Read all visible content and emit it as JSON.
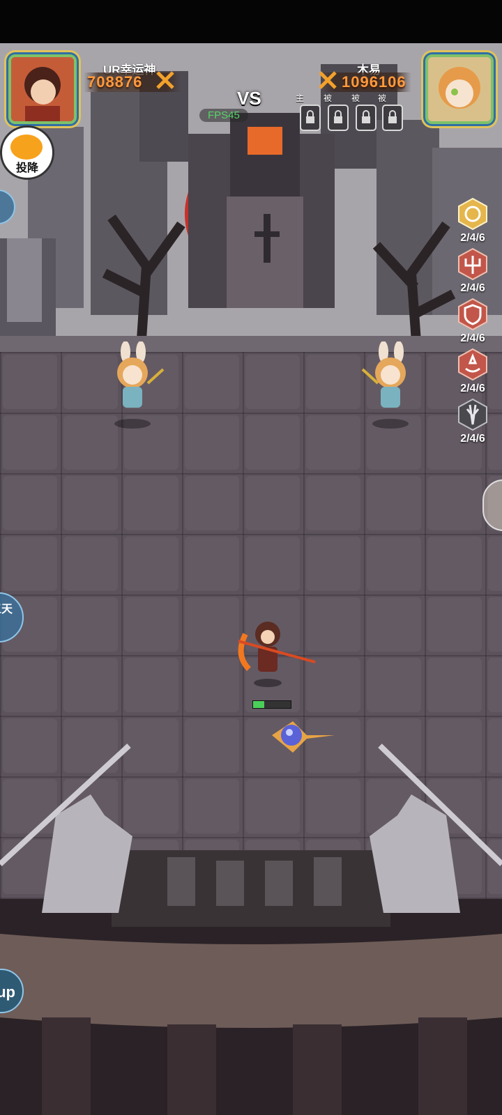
{
  "players": {
    "left": {
      "name": "UR幸运神",
      "power": "708876"
    },
    "right": {
      "name": "木易",
      "power": "1096106"
    }
  },
  "vs_label": "VS",
  "fps_label": "FPS45",
  "lock_slots": [
    "主",
    "被",
    "被",
    "被"
  ],
  "surrender_label": "投降",
  "skills": [
    {
      "icon": "sun-swirl-icon",
      "count": "2/4/6",
      "color": "#e5b64c"
    },
    {
      "icon": "trident-icon",
      "count": "2/4/6",
      "color": "#c2564a"
    },
    {
      "icon": "shield-icon",
      "count": "2/4/6",
      "color": "#c2564a"
    },
    {
      "icon": "rune-hand-icon",
      "count": "2/4/6",
      "color": "#c2564a"
    },
    {
      "icon": "blades-icon",
      "count": "2/4/6",
      "color": "#4a4a4e"
    }
  ],
  "left_edge_button_text": "三天",
  "bottom_left_button_text": "up",
  "hero_hp_fraction": 0.3
}
